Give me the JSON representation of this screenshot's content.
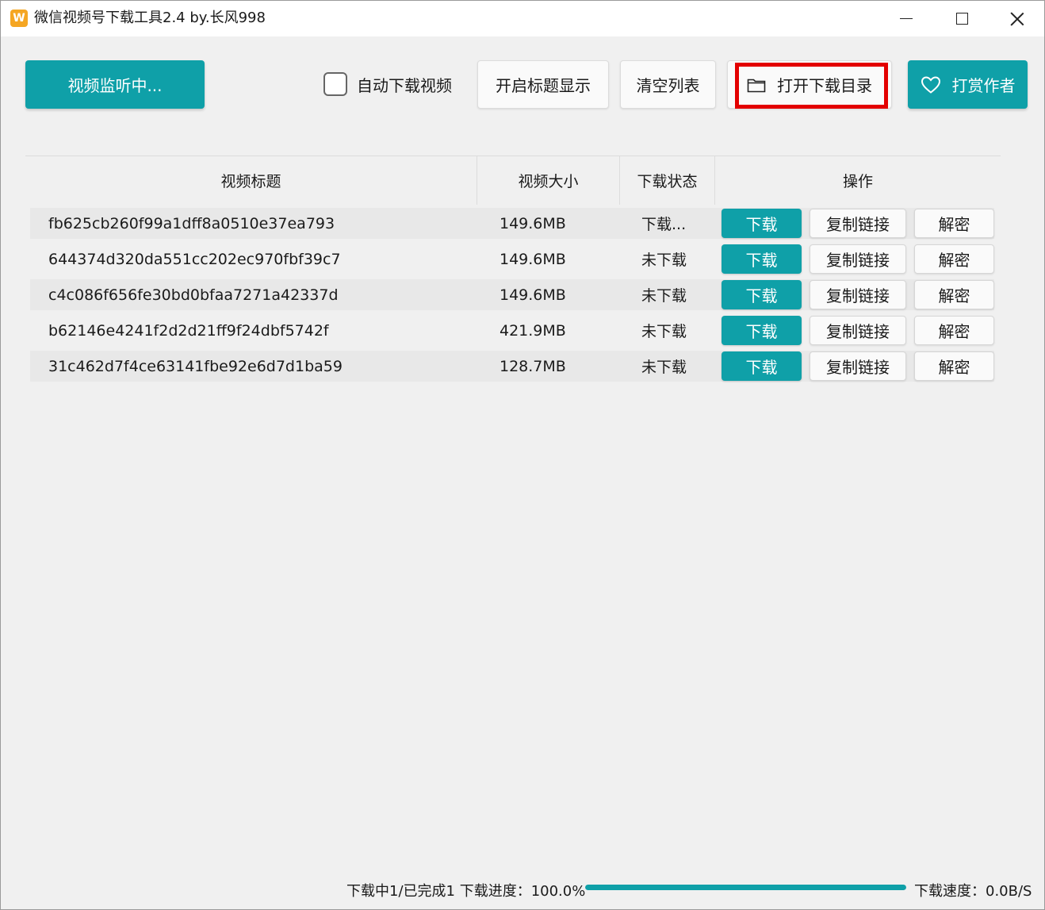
{
  "window": {
    "title": "微信视频号下载工具2.4 by.长风998",
    "icon_letter": "W",
    "accent_color": "#0fa0a8",
    "highlight_color": "#e30000"
  },
  "toolbar": {
    "monitor_label": "视频监听中...",
    "auto_download_label": "自动下载视频",
    "auto_download_checked": false,
    "show_title_label": "开启标题显示",
    "clear_list_label": "清空列表",
    "open_dir_label": "打开下载目录",
    "open_dir_icon": "folder-icon",
    "reward_label": "打赏作者",
    "reward_icon": "heart-icon"
  },
  "table": {
    "headers": [
      "视频标题",
      "视频大小",
      "下载状态",
      "操作"
    ],
    "rows": [
      {
        "title": "fb625cb260f99a1dff8a0510e37ea793",
        "size": "149.6MB",
        "status": "下载...",
        "download": "下载",
        "copy": "复制链接",
        "decrypt": "解密"
      },
      {
        "title": "644374d320da551cc202ec970fbf39c7",
        "size": "149.6MB",
        "status": "未下载",
        "download": "下载",
        "copy": "复制链接",
        "decrypt": "解密"
      },
      {
        "title": "c4c086f656fe30bd0bfaa7271a42337d",
        "size": "149.6MB",
        "status": "未下载",
        "download": "下载",
        "copy": "复制链接",
        "decrypt": "解密"
      },
      {
        "title": "b62146e4241f2d2d21ff9f24dbf5742f",
        "size": "421.9MB",
        "status": "未下载",
        "download": "下载",
        "copy": "复制链接",
        "decrypt": "解密"
      },
      {
        "title": "31c462d7f4ce63141fbe92e6d7d1ba59",
        "size": "128.7MB",
        "status": "未下载",
        "download": "下载",
        "copy": "复制链接",
        "decrypt": "解密"
      }
    ]
  },
  "status": {
    "progress_text": "下载中1/已完成1  下载进度：100.0%",
    "progress_percent": 100,
    "speed_text": "下载速度：0.0B/S"
  }
}
